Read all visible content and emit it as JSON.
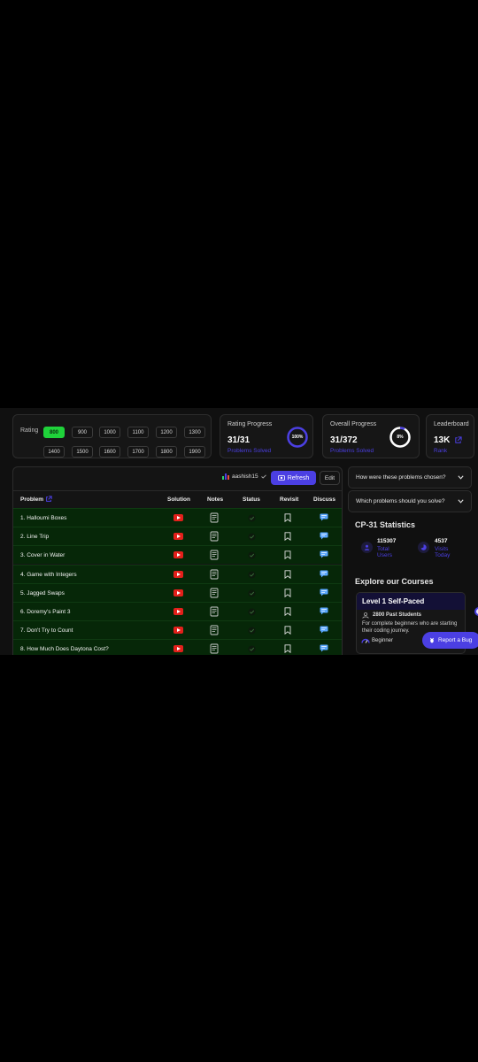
{
  "rating": {
    "label": "Rating",
    "row1": [
      "800",
      "900",
      "1000",
      "1100",
      "1200",
      "1300"
    ],
    "row2": [
      "1400",
      "1500",
      "1600",
      "1700",
      "1800",
      "1900"
    ],
    "selected": "800"
  },
  "rating_progress": {
    "title": "Rating Progress",
    "value": "31/31",
    "sub": "Problems Solved",
    "percent_label": "100%",
    "fraction": 1.0
  },
  "overall_progress": {
    "title": "Overall Progress",
    "value": "31/372",
    "sub": "Problems Solved",
    "percent_label": "8%",
    "fraction": 0.08
  },
  "leaderboard": {
    "title": "Leaderboard",
    "value": "13K",
    "sub": "Rank"
  },
  "toolbar": {
    "username": "aashish15",
    "refresh_label": "Refresh",
    "edit_label": "Edit"
  },
  "table": {
    "headers": {
      "problem": "Problem",
      "solution": "Solution",
      "notes": "Notes",
      "status": "Status",
      "revisit": "Revisit",
      "discuss": "Discuss"
    },
    "rows": [
      "1. Halloumi Boxes",
      "2. Line Trip",
      "3. Cover in Water",
      "4. Game with Integers",
      "5. Jagged Swaps",
      "6. Doremy's Paint 3",
      "7. Don't Try to Count",
      "8. How Much Does Daytona Cost?"
    ]
  },
  "sidebar": {
    "faq1": "How were these problems chosen?",
    "faq2": "Which problems should you solve?",
    "stats_title": "CP-31 Statistics",
    "total_users_num": "115307",
    "total_users_lbl1": "Total",
    "total_users_lbl2": "Users",
    "visits_num": "4537",
    "visits_lbl1": "Visits",
    "visits_lbl2": "Today",
    "courses_title": "Explore our Courses",
    "course_name": "Level 1 Self-Paced",
    "course_students": "2800 Past Students",
    "course_desc": "For complete beginners who are starting their coding journey.",
    "course_level": "Beginner",
    "bug_label": "Report a Bug"
  },
  "colors": {
    "accent": "#4b3fe3",
    "active_rating": "#1fd23a",
    "row_bg": "#062708",
    "youtube": "#e3201b"
  }
}
